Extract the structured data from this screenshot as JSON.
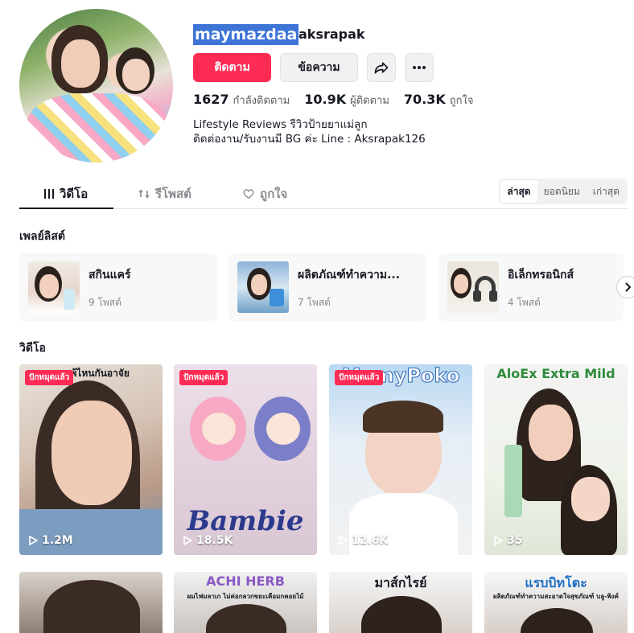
{
  "profile": {
    "username": "maymazdaa",
    "nickname": "aksrapak",
    "follow_label": "ติดตาม",
    "message_label": "ข้อความ",
    "stats": [
      {
        "value": "1627",
        "label": "กำลังติดตาม"
      },
      {
        "value": "10.9K",
        "label": "ผู้ติดตาม"
      },
      {
        "value": "70.3K",
        "label": "ถูกใจ"
      }
    ],
    "bio_line1": "Lifestyle Reviews รีวิวป้ายยาแม่ลูก",
    "bio_line2": "ติดต่องาน/รับงานมี BG ค่ะ Line : Aksrapak126"
  },
  "tabs": [
    {
      "label": "วิดีโอ",
      "icon": "grid-icon"
    },
    {
      "label": "รีโพสต์",
      "icon": "repost-icon"
    },
    {
      "label": "ถูกใจ",
      "icon": "heart-icon"
    }
  ],
  "sort": [
    "ล่าสุด",
    "ยอดนิยม",
    "เก่าสุด"
  ],
  "playlists_title": "เพลย์ลิสต์",
  "playlists": [
    {
      "name": "สกินแคร์",
      "count": "9 โพสต์"
    },
    {
      "name": "ผลิตภัณฑ์ทำความ...",
      "count": "7 โพสต์"
    },
    {
      "name": "อิเล็กทรอนิกส์",
      "count": "4 โพสต์"
    }
  ],
  "videos_title": "วิดีโอ",
  "videos": [
    {
      "pinned": "ปักหมุดแล้ว",
      "views": "1.2M",
      "overlay": "ลูกแพ้ไหนกันอาจัย"
    },
    {
      "pinned": "ปักหมุดแล้ว",
      "views": "18.5K",
      "overlay": "Bambie"
    },
    {
      "pinned": "ปักหมุดแล้ว",
      "views": "12.6K",
      "overlay": "MamyPoko"
    },
    {
      "pinned": "",
      "views": "35",
      "overlay": "AloEx Extra Mild"
    }
  ],
  "videos_row2": [
    {
      "overlay": ""
    },
    {
      "overlay": "ACHI HERB",
      "sub": "ผมไฟมลาเก ไม่ค่อกลวกขยะเคือมกคอยไม้"
    },
    {
      "overlay": "มาส์กไรย์"
    },
    {
      "overlay": "แรบบิทโตะ",
      "sub": "ผลิตภัณฑ์ทำความสะอาดใจสุขภัณฑ์ บลู-พิงค์"
    }
  ],
  "colors": {
    "accent": "#fe2c55",
    "selection": "#3d74d6"
  }
}
